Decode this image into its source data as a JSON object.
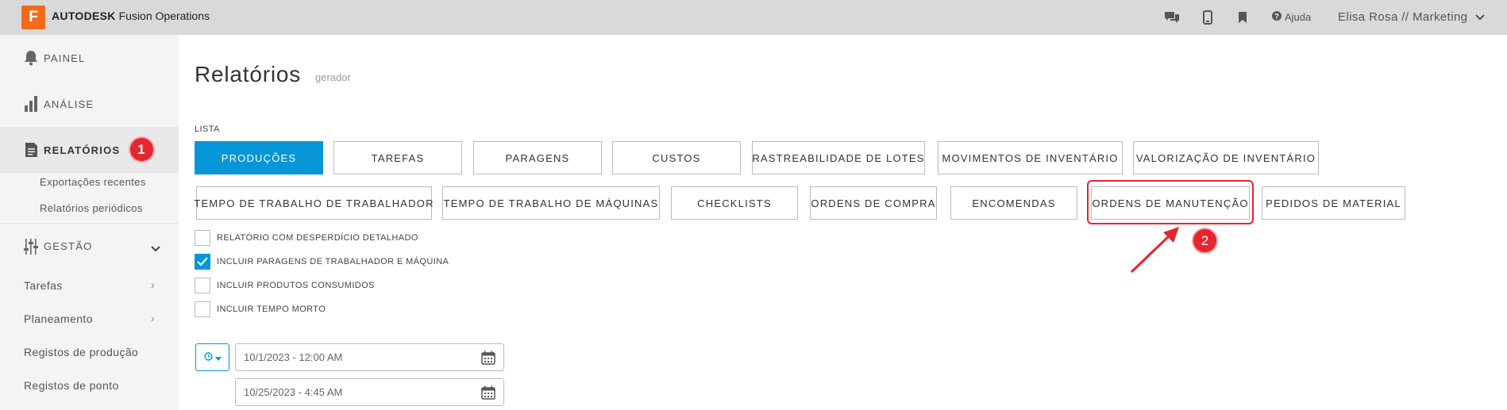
{
  "app": {
    "logo_letter": "F",
    "brand_bold": "AUTODESK",
    "brand_rest": "Fusion Operations"
  },
  "topbar": {
    "help": "Ajuda",
    "user": "Elisa Rosa // Marketing",
    "icons": [
      "chat-icon",
      "mobile-icon",
      "bookmark-icon",
      "question-icon",
      "chevron-down-icon"
    ]
  },
  "sidebar": {
    "painel": "PAINEL",
    "analise": "ANÁLISE",
    "relatorios": "RELATÓRIOS",
    "relatorios_badge": "1",
    "sub_exportacoes": "Exportações recentes",
    "sub_periodicos": "Relatórios periódicos",
    "gestao": "GESTÃO",
    "tarefas": "Tarefas",
    "planeamento": "Planeamento",
    "registos_producao": "Registos de produção",
    "registos_ponto": "Registos de ponto"
  },
  "main": {
    "title": "Relatórios",
    "subtitle": "gerador",
    "lista_label": "LISTA",
    "row1": [
      "PRODUÇÕES",
      "TAREFAS",
      "PARAGENS",
      "CUSTOS",
      "RASTREABILIDADE DE LOTES",
      "MOVIMENTOS DE INVENTÁRIO",
      "VALORIZAÇÃO DE INVENTÁRIO"
    ],
    "row2": [
      "TEMPO DE TRABALHO DE TRABALHADOR",
      "TEMPO DE TRABALHO DE MÁQUINAS",
      "CHECKLISTS",
      "ORDENS DE COMPRA",
      "ENCOMENDAS",
      "ORDENS DE MANUTENÇÃO",
      "PEDIDOS DE MATERIAL"
    ],
    "active_report": "PRODUÇÕES",
    "annotation_badge": "2",
    "checkboxes": [
      {
        "label": "RELATÓRIO COM DESPERDÍCIO DETALHADO",
        "checked": false
      },
      {
        "label": "INCLUIR PARAGENS DE TRABALHADOR E MÁQUINA",
        "checked": true
      },
      {
        "label": "INCLUIR PRODUTOS CONSUMIDOS",
        "checked": false
      },
      {
        "label": "INCLUIR TEMPO MORTO",
        "checked": false
      }
    ],
    "date_from": "10/1/2023 - 12:00 AM",
    "date_to": "10/25/2023 - 4:45 AM"
  },
  "colors": {
    "accent": "#0696d7",
    "brand": "#f26b1d",
    "annotation": "#e5262f"
  }
}
